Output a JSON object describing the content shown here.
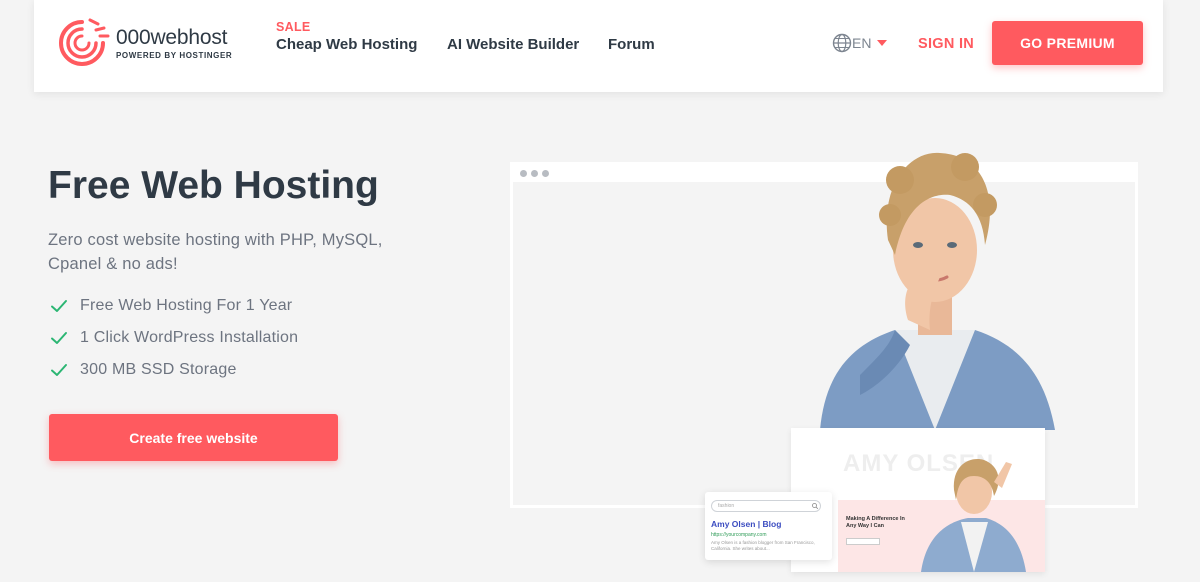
{
  "brand": {
    "name": "000webhost",
    "sub": "POWERED BY HOSTINGER"
  },
  "nav": {
    "sale_badge": "SALE",
    "items": [
      {
        "label": "Cheap Web Hosting"
      },
      {
        "label": "AI Website Builder"
      },
      {
        "label": "Forum"
      }
    ],
    "language": "EN",
    "sign_in": "SIGN IN",
    "premium": "GO PREMIUM"
  },
  "hero": {
    "title": "Free Web Hosting",
    "subtitle": "Zero cost website hosting with PHP, MySQL, Cpanel & no ads!",
    "features": [
      "Free Web Hosting For 1 Year",
      "1 Click WordPress Installation",
      "300 MB SSD Storage"
    ],
    "cta": "Create free website"
  },
  "illustration": {
    "mini_site_title": "AMY OLSEN",
    "mini_site_heading": "Making A Difference In Any Way I Can",
    "search_placeholder": "fashion",
    "search_result_title": "Amy Olsen | Blog",
    "search_result_url": "https://yourcompany.com",
    "search_result_desc": "Amy Olsen is a fashion blogger from San Francisco, California. She writes about..."
  },
  "colors": {
    "accent": "#ff5a5f",
    "text": "#2f3a45",
    "check": "#2bb673"
  }
}
